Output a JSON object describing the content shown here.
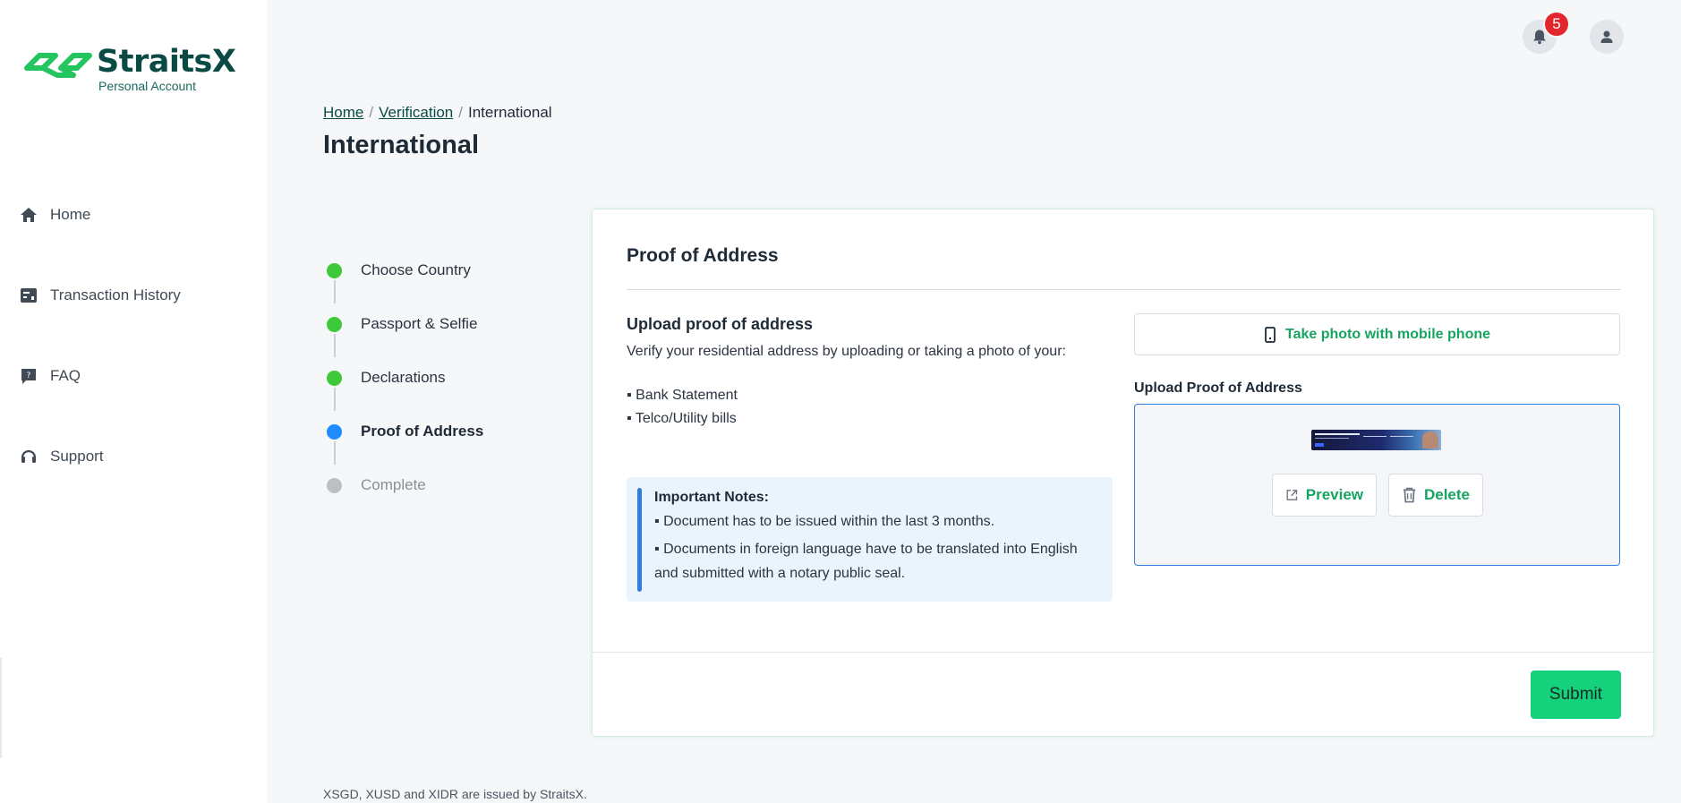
{
  "brand": {
    "name": "StraitsX",
    "subtitle": "Personal Account",
    "primary_color": "#0a4a45",
    "accent_color": "#13d27b"
  },
  "sidebar": {
    "items": [
      {
        "label": "Home",
        "icon": "home-icon"
      },
      {
        "label": "Transaction History",
        "icon": "receipt-icon"
      },
      {
        "label": "FAQ",
        "icon": "faq-icon"
      },
      {
        "label": "Support",
        "icon": "headset-icon"
      }
    ]
  },
  "header": {
    "notification_count": "5",
    "notification_icon": "bell-icon",
    "profile_icon": "user-icon"
  },
  "breadcrumb": {
    "home": "Home",
    "verification": "Verification",
    "current": "International",
    "separator": "/"
  },
  "page": {
    "title": "International"
  },
  "stepper": {
    "steps": [
      {
        "label": "Choose Country",
        "status": "done"
      },
      {
        "label": "Passport & Selfie",
        "status": "done"
      },
      {
        "label": "Declarations",
        "status": "done"
      },
      {
        "label": "Proof of Address",
        "status": "active"
      },
      {
        "label": "Complete",
        "status": "todo"
      }
    ],
    "colors": {
      "done": "#3ec93b",
      "active": "#1f8cff",
      "todo": "#bdbfc3"
    }
  },
  "card": {
    "title": "Proof of Address",
    "upload_title": "Upload proof of address",
    "upload_description": "Verify your residential address by uploading or taking a photo of your:",
    "document_types": [
      "▪ Bank Statement",
      "▪ Telco/Utility bills"
    ],
    "notes": {
      "title": "Important Notes:",
      "items": [
        "▪ Document has to be issued within the last 3 months.",
        "▪ Documents in foreign language have to be translated into English and submitted with a notary public seal."
      ]
    },
    "take_photo_label": "Take photo with mobile phone",
    "upload_label": "Upload Proof of Address",
    "preview_label": "Preview",
    "delete_label": "Delete",
    "submit_label": "Submit"
  },
  "footer": {
    "text": "XSGD, XUSD and XIDR are issued by StraitsX."
  }
}
